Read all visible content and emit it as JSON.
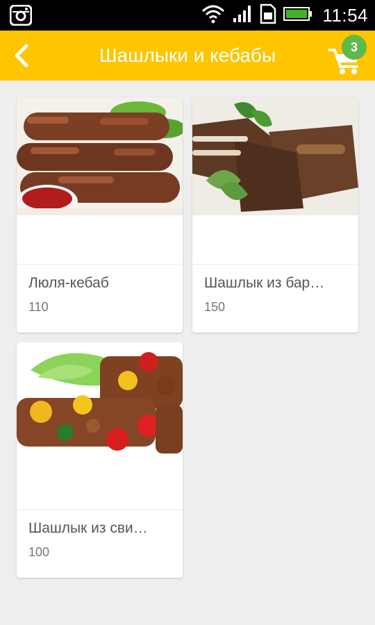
{
  "status_bar": {
    "time": "11:54",
    "icons": [
      "instagram-icon",
      "wifi-icon",
      "signal-icon",
      "sim-icon",
      "battery-icon"
    ]
  },
  "header": {
    "title": "Шашлыки и кебабы",
    "back_icon": "chevron-left-icon",
    "cart_icon": "cart-icon",
    "cart_count": "3",
    "background": "#ffc500",
    "badge_color": "#5fb84a"
  },
  "products": [
    {
      "name": "Люля-кебаб",
      "price": "110",
      "image": "lyulya-kebab-photo"
    },
    {
      "name": "Шашлык из бар…",
      "price": "150",
      "image": "lamb-chops-photo"
    },
    {
      "name": "Шашлык из сви…",
      "price": "100",
      "image": "pork-skewers-photo"
    }
  ]
}
